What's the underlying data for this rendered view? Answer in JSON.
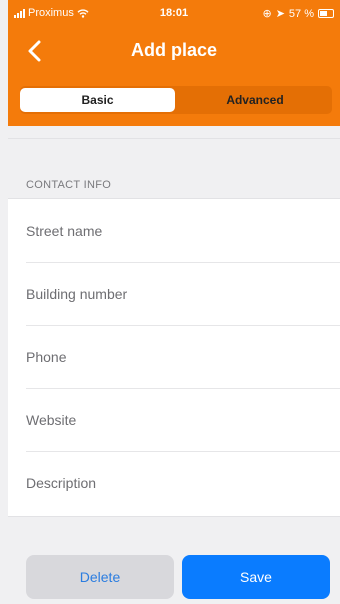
{
  "status_bar": {
    "carrier": "Proximus",
    "time": "18:01",
    "battery": "57 %"
  },
  "header": {
    "title": "Add place",
    "back_icon": "chevron-left-icon"
  },
  "tabs": {
    "basic": "Basic",
    "advanced": "Advanced",
    "selected": "Basic"
  },
  "section": {
    "title": "CONTACT INFO"
  },
  "fields": {
    "street_name": {
      "placeholder": "Street name",
      "value": ""
    },
    "building_number": {
      "placeholder": "Building number",
      "value": ""
    },
    "phone": {
      "placeholder": "Phone",
      "value": ""
    },
    "website": {
      "placeholder": "Website",
      "value": ""
    },
    "description": {
      "placeholder": "Description",
      "value": ""
    }
  },
  "actions": {
    "delete_label": "Delete",
    "save_label": "Save"
  },
  "colors": {
    "header": "#f47b0b",
    "save_button": "#0a7cff",
    "delete_button": "#d8d8dc",
    "delete_text": "#2b7de0"
  }
}
